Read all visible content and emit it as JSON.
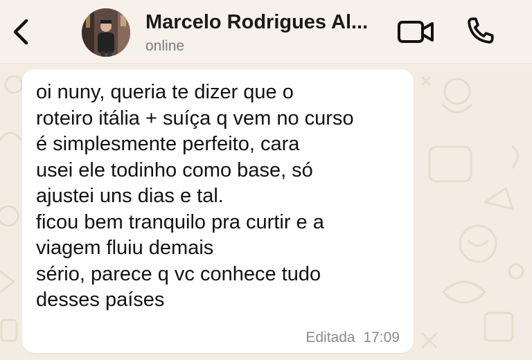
{
  "header": {
    "contact_name": "Marcelo Rodrigues Al...",
    "status": "online",
    "icons": {
      "back": "chevron-left-icon",
      "video": "video-camera-icon",
      "call": "phone-icon"
    }
  },
  "message": {
    "text": "oi nuny, queria te dizer que o\nroteiro itália + suíça q vem no curso\né simplesmente perfeito, cara\nusei ele todinho como base, só\najustei uns dias e tal.\nficou bem tranquilo pra curtir e a\nviagem fluiu demais\nsério, parece q vc conhece tudo\ndesses países",
    "edited_label": "Editada",
    "time": "17:09"
  },
  "colors": {
    "accent": "#111111",
    "background": "#f3ece3",
    "bubble": "#ffffff"
  }
}
